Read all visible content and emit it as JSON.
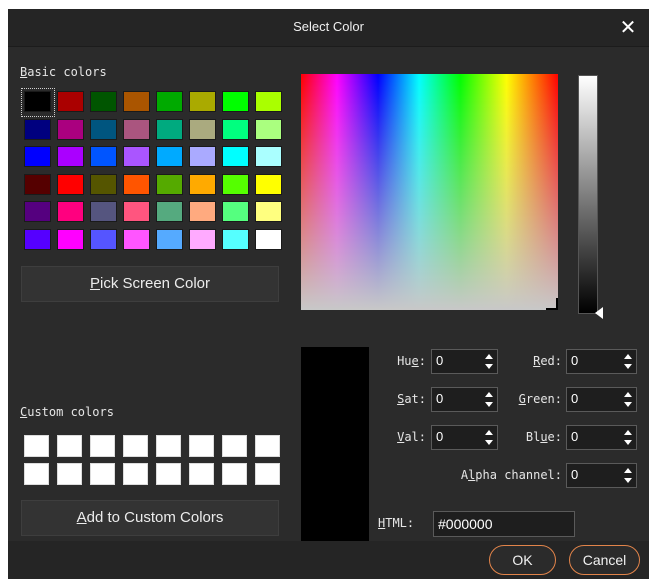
{
  "dialog": {
    "title": "Select Color",
    "close_glyph": "✕"
  },
  "basic_colors": {
    "label_prefix": "",
    "label_access": "B",
    "label_rest": "asic colors",
    "swatches": [
      "#000000",
      "#aa0000",
      "#005500",
      "#aa5500",
      "#00aa00",
      "#aaaa00",
      "#00ff00",
      "#aaff00",
      "#00007f",
      "#aa007f",
      "#00557f",
      "#aa557f",
      "#00aa7f",
      "#aaaa7f",
      "#00ff7f",
      "#aaff7f",
      "#0000ff",
      "#aa00ff",
      "#0055ff",
      "#aa55ff",
      "#00aaff",
      "#aaaaff",
      "#00ffff",
      "#aaffff",
      "#550000",
      "#ff0000",
      "#555500",
      "#ff5500",
      "#55aa00",
      "#ffaa00",
      "#55ff00",
      "#ffff00",
      "#55007f",
      "#ff007f",
      "#55557f",
      "#ff557f",
      "#55aa7f",
      "#ffaa7f",
      "#55ff7f",
      "#ffff7f",
      "#5500ff",
      "#ff00ff",
      "#5555ff",
      "#ff55ff",
      "#55aaff",
      "#ffaaff",
      "#55ffff",
      "#ffffff"
    ],
    "selected_index": 0
  },
  "pick_button": {
    "access": "P",
    "rest": "ick Screen Color"
  },
  "custom_colors": {
    "label_access": "C",
    "label_rest": "ustom colors",
    "swatches": [
      "#ffffff",
      "#ffffff",
      "#ffffff",
      "#ffffff",
      "#ffffff",
      "#ffffff",
      "#ffffff",
      "#ffffff",
      "#ffffff",
      "#ffffff",
      "#ffffff",
      "#ffffff",
      "#ffffff",
      "#ffffff",
      "#ffffff",
      "#ffffff"
    ]
  },
  "add_button": {
    "access": "A",
    "rest": "dd to Custom Colors"
  },
  "fields": {
    "hue": {
      "pre": "Hu",
      "access": "e",
      "post": ":",
      "value": "0"
    },
    "sat": {
      "pre": "",
      "access": "S",
      "post": "at:",
      "value": "0"
    },
    "val": {
      "pre": "",
      "access": "V",
      "post": "al:",
      "value": "0"
    },
    "red": {
      "pre": "",
      "access": "R",
      "post": "ed:",
      "value": "0"
    },
    "green": {
      "pre": "",
      "access": "G",
      "post": "reen:",
      "value": "0"
    },
    "blue": {
      "pre": "Bl",
      "access": "u",
      "post": "e:",
      "value": "0"
    },
    "alpha": {
      "pre": "A",
      "access": "l",
      "post": "pha channel:",
      "value": "0"
    },
    "html": {
      "pre": "",
      "access": "H",
      "post": "TML:",
      "value": "#000000"
    }
  },
  "current_color": "#000000",
  "footer": {
    "ok_label": "OK",
    "cancel_label": "Cancel"
  },
  "accent_color": "#e2844a"
}
